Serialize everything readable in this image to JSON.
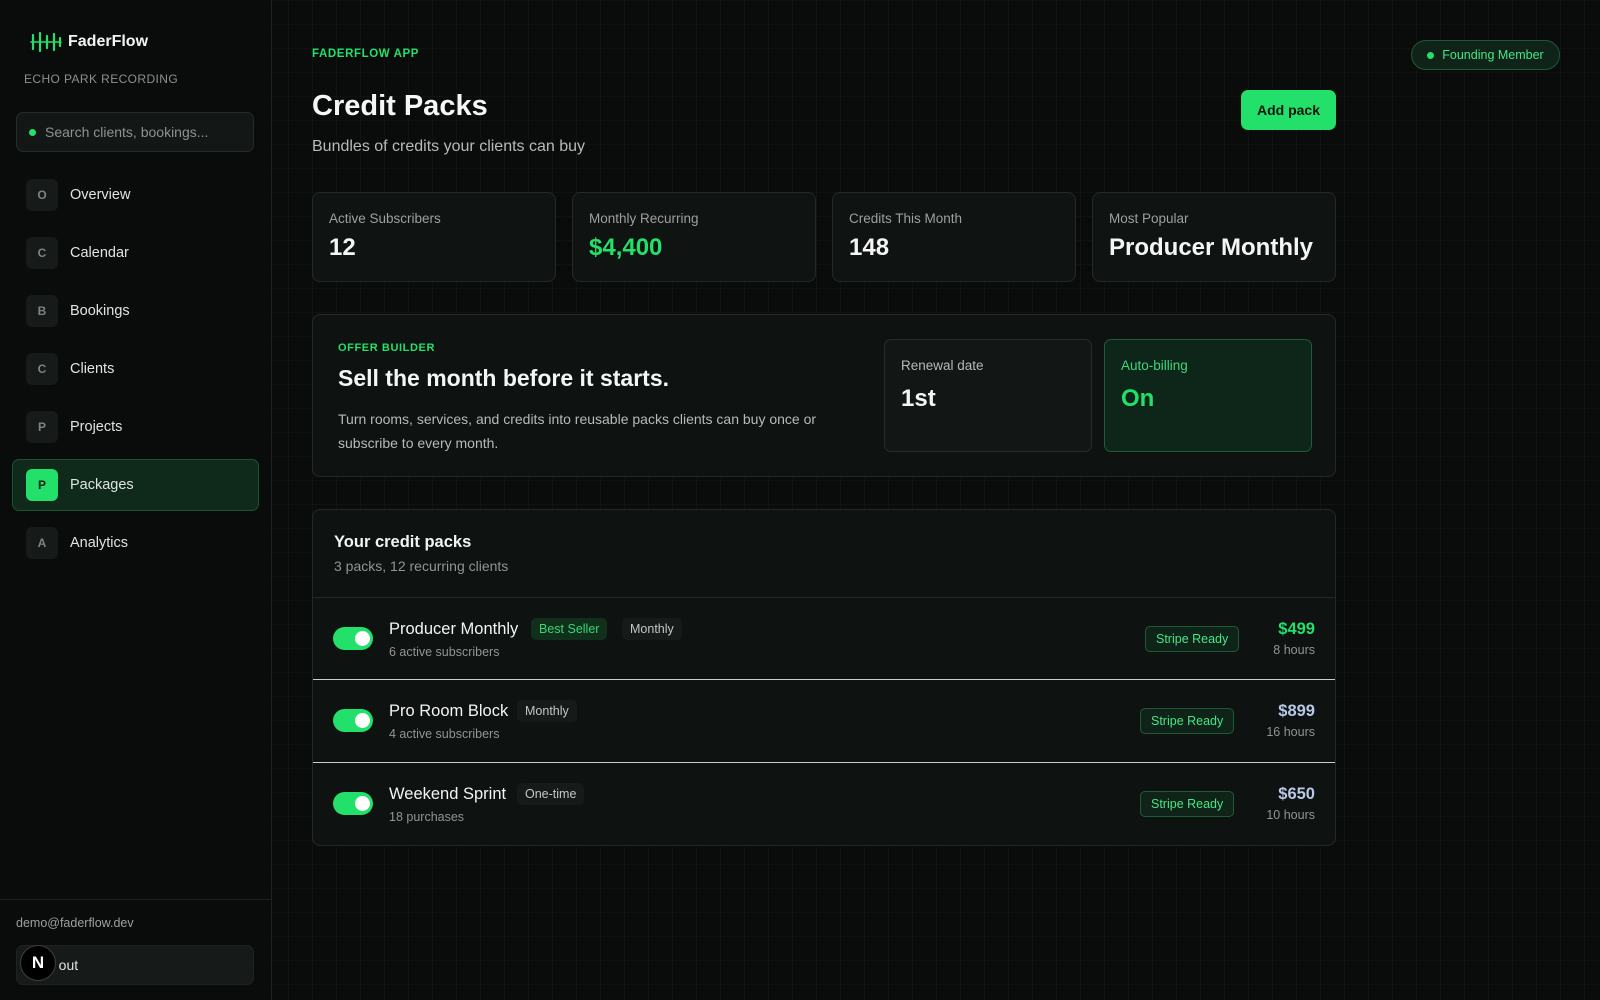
{
  "brand": {
    "name": "FaderFlow",
    "studio": "ECHO PARK RECORDING"
  },
  "search": {
    "placeholder": "Search clients, bookings..."
  },
  "nav": [
    {
      "letter": "O",
      "label": "Overview"
    },
    {
      "letter": "C",
      "label": "Calendar"
    },
    {
      "letter": "B",
      "label": "Bookings"
    },
    {
      "letter": "C",
      "label": "Clients"
    },
    {
      "letter": "P",
      "label": "Projects"
    },
    {
      "letter": "P",
      "label": "Packages",
      "active": true
    },
    {
      "letter": "A",
      "label": "Analytics"
    }
  ],
  "footer": {
    "email": "demo@faderflow.dev",
    "signout": "n out",
    "avatar_letter": "N"
  },
  "header": {
    "eyebrow": "FADERFLOW APP",
    "title": "Credit Packs",
    "subtitle": "Bundles of credits your clients can buy",
    "badge": "Founding Member",
    "add_button": "Add pack"
  },
  "stats": [
    {
      "label": "Active Subscribers",
      "value": "12"
    },
    {
      "label": "Monthly Recurring",
      "value": "$4,400",
      "accent": true
    },
    {
      "label": "Credits This Month",
      "value": "148"
    },
    {
      "label": "Most Popular",
      "value": "Producer Monthly"
    }
  ],
  "offer": {
    "eyebrow": "OFFER BUILDER",
    "title": "Sell the month before it starts.",
    "description": "Turn rooms, services, and credits into reusable packs clients can buy once or subscribe to every month.",
    "renewal": {
      "label": "Renewal date",
      "value": "1st"
    },
    "autobilling": {
      "label": "Auto-billing",
      "value": "On"
    }
  },
  "packs": {
    "title": "Your credit packs",
    "subtitle": "3 packs, 12 recurring clients",
    "items": [
      {
        "name": "Producer Monthly",
        "tags": [
          "Best Seller",
          "Monthly"
        ],
        "meta": "6 active subscribers",
        "status": "Stripe Ready",
        "price": "$499",
        "hours": "8 hours",
        "enabled": true
      },
      {
        "name": "Pro Room Block",
        "tags": [
          "Monthly"
        ],
        "meta": "4 active subscribers",
        "status": "Stripe Ready",
        "price": "$899",
        "hours": "16 hours",
        "enabled": true
      },
      {
        "name": "Weekend Sprint",
        "tags": [
          "One-time"
        ],
        "meta": "18 purchases",
        "status": "Stripe Ready",
        "price": "$650",
        "hours": "10 hours",
        "enabled": true
      }
    ]
  },
  "colors": {
    "accent": "#22e06a",
    "background": "#0a0c0c",
    "price_alt": "#b8c8e6"
  }
}
